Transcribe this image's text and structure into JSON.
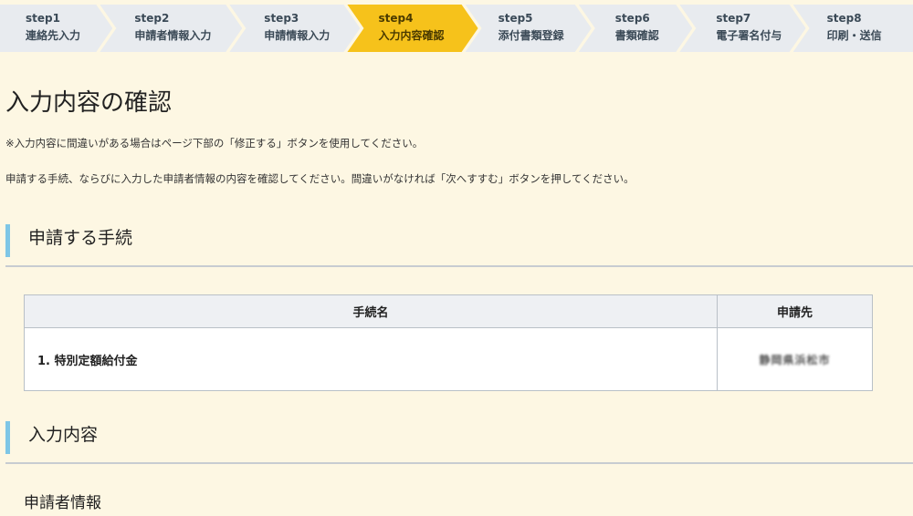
{
  "steps": [
    {
      "num": "step1",
      "label": "連絡先入力"
    },
    {
      "num": "step2",
      "label": "申請者情報入力"
    },
    {
      "num": "step3",
      "label": "申請情報入力"
    },
    {
      "num": "step4",
      "label": "入力内容確認"
    },
    {
      "num": "step5",
      "label": "添付書類登録"
    },
    {
      "num": "step6",
      "label": "書類確認"
    },
    {
      "num": "step7",
      "label": "電子署名付与"
    },
    {
      "num": "step8",
      "label": "印刷・送信"
    }
  ],
  "active_step": "step4",
  "page": {
    "title": "入力内容の確認",
    "note": "※入力内容に間違いがある場合はページ下部の「修正する」ボタンを使用してください。",
    "description": "申請する手続、ならびに入力した申請者情報の内容を確認してください。間違いがなければ「次へすすむ」ボタンを押してください。"
  },
  "section_procedure": {
    "heading": "申請する手続",
    "table": {
      "headers": [
        "手続名",
        "申請先"
      ],
      "rows": [
        {
          "name": "1. 特別定額給付金",
          "destination": "静岡県浜松市"
        }
      ]
    }
  },
  "section_input": {
    "heading": "入力内容",
    "subheading": "申請者情報"
  },
  "colors": {
    "background": "#fdf7e3",
    "active_step": "#f6c21b",
    "inactive_step": "#e8ebef",
    "section_accent": "#7ec6e6"
  }
}
